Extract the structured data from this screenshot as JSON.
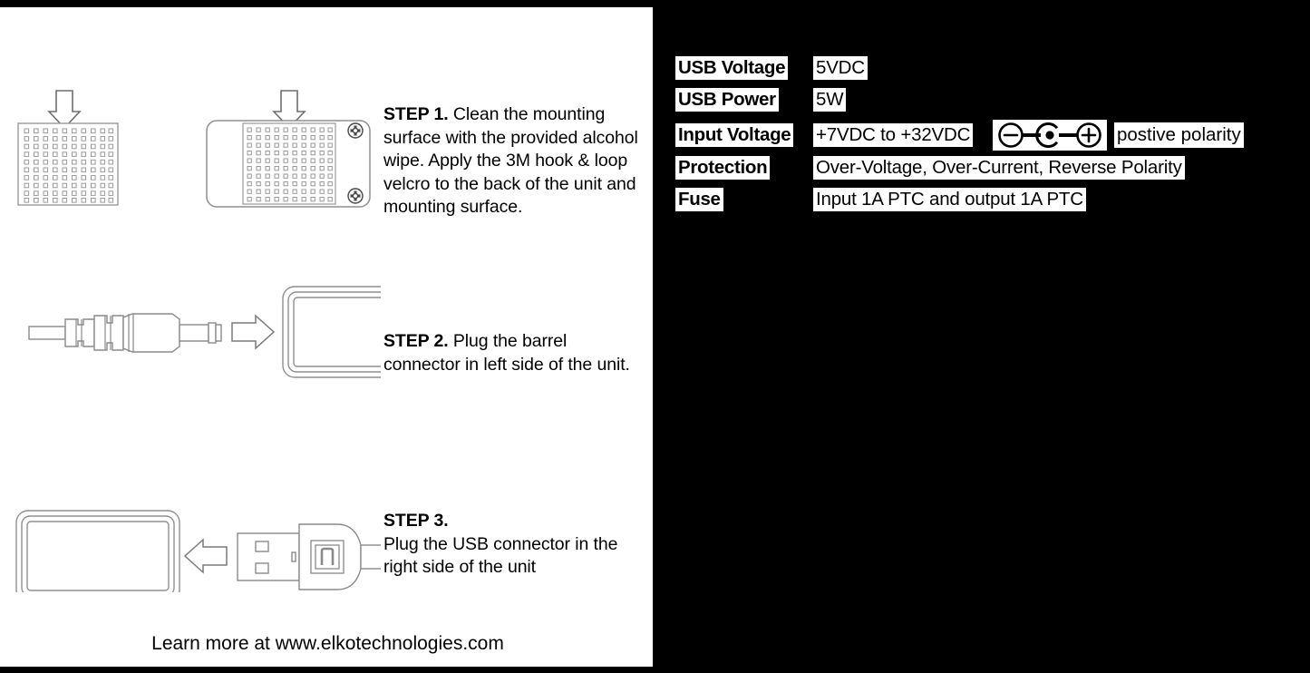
{
  "panel": {
    "footer": "Learn more at www.elkotechnologies.com"
  },
  "steps": [
    {
      "id": "step-1",
      "label": "STEP 1.",
      "body": " Clean the mounting surface with the provided alcohol wipe. Apply the 3M hook & loop velcro to the back of the unit and mounting surface.",
      "label_on_own_line": false,
      "diagram": "velcro-pad-and-unit-back-with-arrows"
    },
    {
      "id": "step-2",
      "label": "STEP 2.",
      "body": " Plug the barrel connector in left side of the unit.",
      "label_on_own_line": false,
      "diagram": "barrel-connector-into-unit-left"
    },
    {
      "id": "step-3",
      "label": "STEP 3.",
      "body": "Plug the USB connector in the right side of the unit",
      "label_on_own_line": true,
      "diagram": "usb-connector-into-unit-right"
    }
  ],
  "specs": {
    "rows": [
      {
        "key": "USB Voltage",
        "value": "5VDC",
        "extra": null,
        "polarity_symbol": false
      },
      {
        "key": "USB Power",
        "value": "5W",
        "extra": null,
        "polarity_symbol": false
      },
      {
        "key": "Input Voltage",
        "value": "+7VDC to +32VDC",
        "extra": "postive polarity",
        "polarity_symbol": true
      },
      {
        "key": "Protection",
        "value": "Over-Voltage, Over-Current, Reverse Polarity",
        "extra": null,
        "polarity_symbol": false
      },
      {
        "key": "Fuse",
        "value": "Input 1A PTC and output 1A PTC",
        "extra": null,
        "polarity_symbol": false
      }
    ],
    "polarity": {
      "negative_glyph": "minus-in-circle",
      "center_glyph": "center-pin-c",
      "positive_glyph": "plus-in-circle"
    }
  },
  "colors": {
    "background": "#000000",
    "panel": "#ffffff",
    "ink": "#000000",
    "line_art": "#7a7a7a",
    "line_art_dark": "#555555"
  }
}
